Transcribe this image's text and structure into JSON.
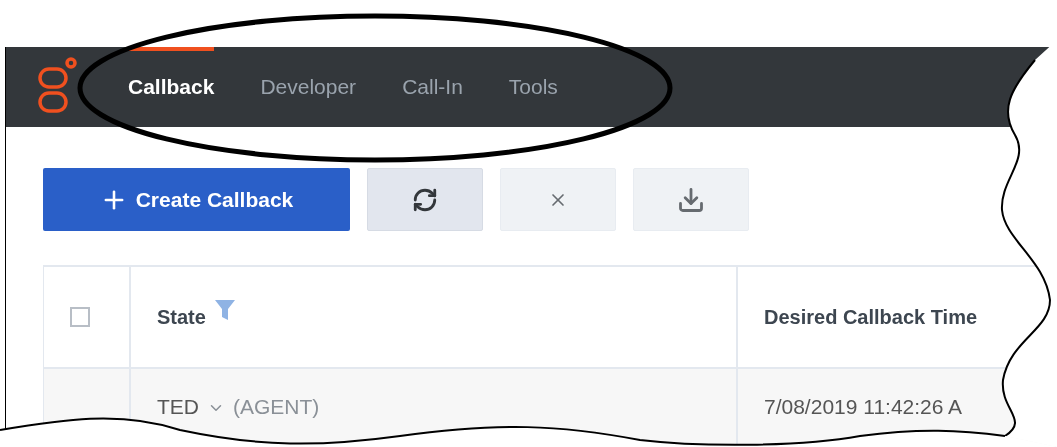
{
  "nav": {
    "tabs": [
      {
        "label": "Callback",
        "selected": true
      },
      {
        "label": "Developer",
        "selected": false
      },
      {
        "label": "Call-In",
        "selected": false
      },
      {
        "label": "Tools",
        "selected": false
      }
    ]
  },
  "toolbar": {
    "create_button": {
      "label": "Create Callback"
    },
    "icon_buttons": [
      {
        "kind": "refresh",
        "disabled": false
      },
      {
        "kind": "cancel",
        "disabled": true
      },
      {
        "kind": "download",
        "disabled": true
      }
    ]
  },
  "table": {
    "select_all": {
      "checked": false
    },
    "columns": [
      {
        "label": "State",
        "filtered": true
      },
      {
        "label": "Desired Callback Time",
        "filtered": false
      }
    ],
    "rows": [
      {
        "state": "TED",
        "assignee": "(AGENT)",
        "desired_time": "7/08/2019 11:42:26 A"
      }
    ]
  }
}
